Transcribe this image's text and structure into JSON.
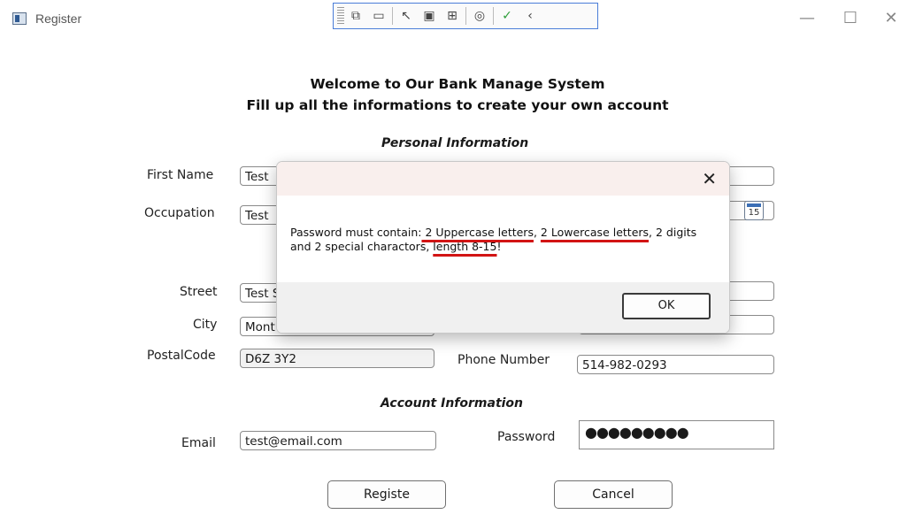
{
  "window": {
    "title": "Register",
    "controls": {
      "minimize": "—",
      "maximize": "☐",
      "close": "✕"
    }
  },
  "debug_toolbar": {
    "icons": [
      "select-element-icon",
      "video-icon",
      "pointer-icon",
      "frame-icon",
      "display-layout-icon",
      "track-focus-icon",
      "check-icon",
      "collapse-icon"
    ],
    "glyphs": [
      "⧉",
      "▭",
      "↖",
      "▣",
      "⊞",
      "◎",
      "✓",
      "‹"
    ]
  },
  "header": {
    "line1": "Welcome to Our Bank Manage System",
    "line2": "Fill up all the informations to create your own account"
  },
  "personal": {
    "section_title": "Personal Information",
    "first_name_label": "First Name",
    "first_name_value": "Test",
    "occupation_label": "Occupation",
    "occupation_value": "Test",
    "calendar_day": "15",
    "street_label": "Street",
    "street_value": "Test S",
    "city_label": "City",
    "city_value": "Mont",
    "postal_label": "PostalCode",
    "postal_value": "D6Z 3Y2",
    "phone_label": "Phone Number",
    "phone_value": "514-982-0293"
  },
  "account": {
    "section_title": "Account Information",
    "email_label": "Email",
    "email_value": "test@email.com",
    "password_label": "Password",
    "password_value": "●●●●●●●●●"
  },
  "buttons": {
    "register": "Registe",
    "cancel": "Cancel"
  },
  "dialog": {
    "close": "✕",
    "message_parts": [
      "Password must contain:",
      " 2 Uppercase letters",
      ", ",
      "2 Lowercase letters",
      ", 2 digits and 2 special charactors, ",
      "length 8-15",
      "!"
    ],
    "ok": "OK"
  },
  "colors": {
    "dialog_header": "#f9efed",
    "annotation_underline": "#d21414",
    "toolbar_border": "#4a7dd8"
  }
}
